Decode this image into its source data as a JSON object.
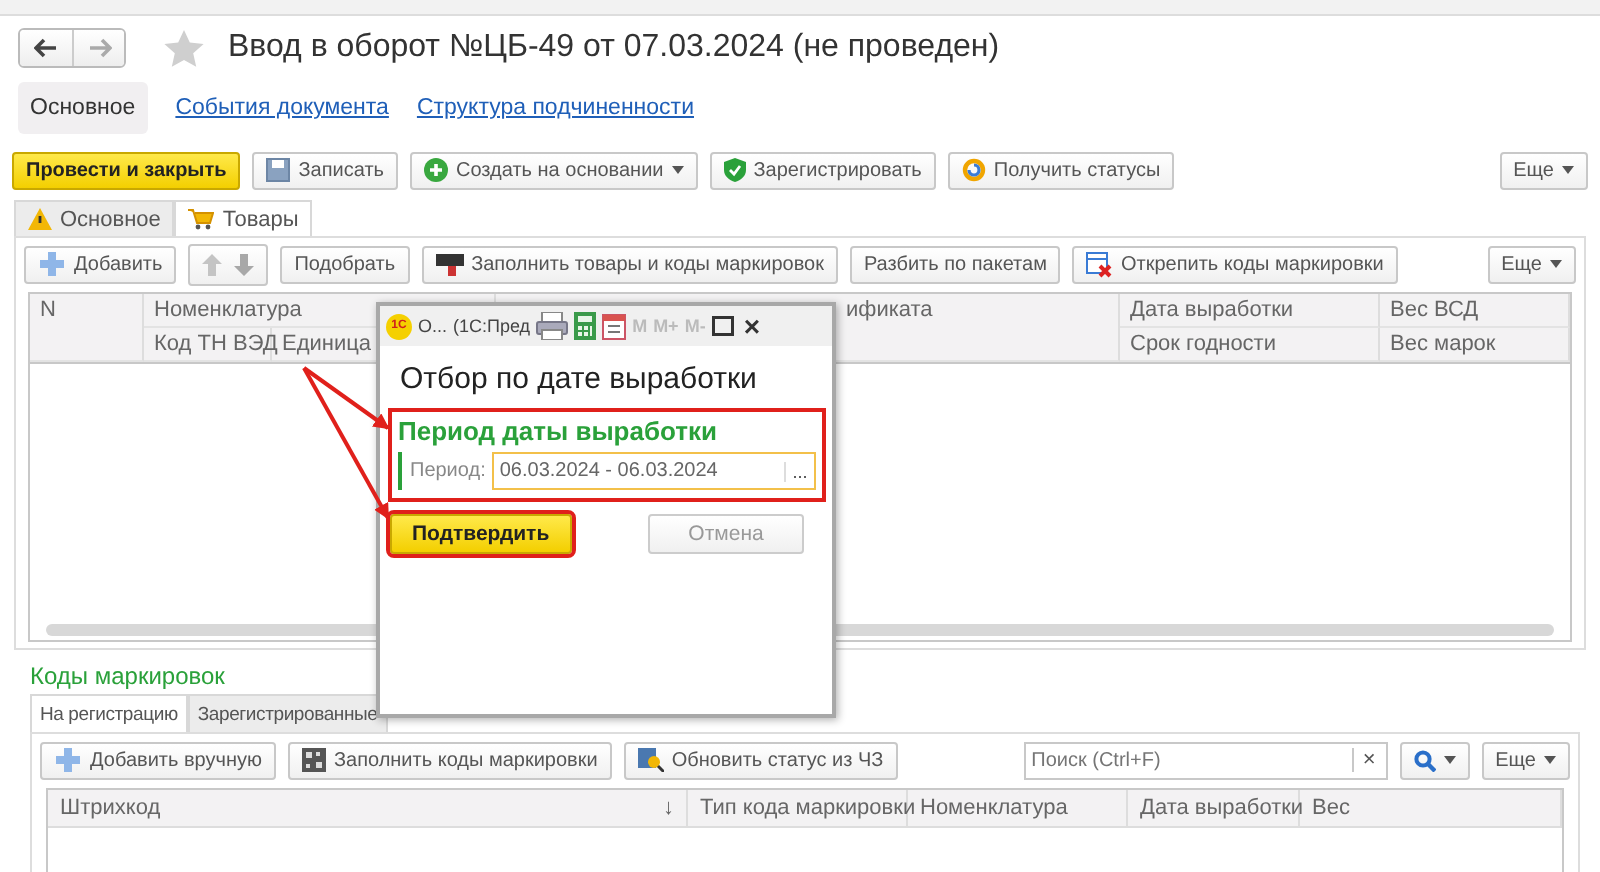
{
  "window": {
    "title": "Ввод в оборот №ЦБ-49 от 07.03.2024 (не проведен)"
  },
  "link_tabs": [
    {
      "label": "Основное",
      "selected": true
    },
    {
      "label": "События документа",
      "selected": false
    },
    {
      "label": "Структура подчиненности",
      "selected": false
    }
  ],
  "toolbar": {
    "buttons": [
      {
        "label": "Провести и закрыть",
        "kind": "primary"
      },
      {
        "label": "Записать",
        "kind": "save"
      },
      {
        "label": "Создать на основании",
        "kind": "create",
        "dropdown": true
      },
      {
        "label": "Зарегистрировать",
        "kind": "shield"
      },
      {
        "label": "Получить статусы",
        "kind": "refresh"
      }
    ],
    "more": "Еще"
  },
  "tabs": [
    {
      "label": "Основное",
      "kind": "warning",
      "selected": false
    },
    {
      "label": "Товары",
      "kind": "cart",
      "selected": true
    }
  ],
  "goods": {
    "buttons": [
      {
        "label": "Добавить",
        "kind": "add"
      },
      {
        "kind": "updown"
      },
      {
        "label": "Подобрать",
        "kind": "plain"
      },
      {
        "label": "Заполнить товары и коды маркировок",
        "kind": "fill"
      },
      {
        "label": "Разбить по пакетам",
        "kind": "plain"
      },
      {
        "label": "Открепить коды маркировки",
        "kind": "detach"
      }
    ],
    "more": "Еще",
    "columns": [
      {
        "label": "N"
      },
      {
        "label": "Номенклатура",
        "sub": [
          "Код ТН ВЭД",
          "Единица"
        ]
      },
      {
        "label": "ификата"
      },
      {
        "label": "Дата выработки",
        "sub": [
          "Срок годности"
        ]
      },
      {
        "label": "Вес ВСД",
        "sub": [
          "Вес марок"
        ]
      }
    ]
  },
  "markings": {
    "title": "Коды маркировок",
    "tabs": [
      {
        "label": "На регистрацию",
        "selected": true
      },
      {
        "label": "Зарегистрированные",
        "selected": false
      }
    ],
    "buttons": [
      {
        "label": "Добавить вручную",
        "kind": "add"
      },
      {
        "label": "Заполнить коды маркировки",
        "kind": "qr"
      },
      {
        "label": "Обновить статус из ЧЗ",
        "kind": "update"
      }
    ],
    "search": {
      "placeholder": "Поиск (Ctrl+F)",
      "clear": "×"
    },
    "more": "Еще",
    "columns": [
      {
        "label": "Штрихкод",
        "sort": "↓"
      },
      {
        "label": "Тип кода маркировки"
      },
      {
        "label": "Номенклатура"
      },
      {
        "label": "Дата выработки"
      },
      {
        "label": "Вес"
      }
    ]
  },
  "dialog": {
    "logo": "1С",
    "caption": "О...",
    "app": "(1С:Пред",
    "memory": [
      {
        "label": "M",
        "disabled": true
      },
      {
        "label": "M+",
        "disabled": true
      },
      {
        "label": "M-",
        "disabled": true
      }
    ],
    "close": "×",
    "heading": "Отбор по дате выработки",
    "group": {
      "title": "Период даты выработки",
      "highlighted": true,
      "field_label": "Период:",
      "value": "06.03.2024 - 06.03.2024",
      "choose": "..."
    },
    "buttons": [
      {
        "label": "Подтвердить",
        "kind": "primary",
        "highlighted": true
      },
      {
        "label": "Отмена",
        "kind": "plain",
        "highlighted": false
      }
    ]
  },
  "annotations": [
    {
      "kind": "arrow"
    },
    {
      "kind": "arrow"
    }
  ]
}
